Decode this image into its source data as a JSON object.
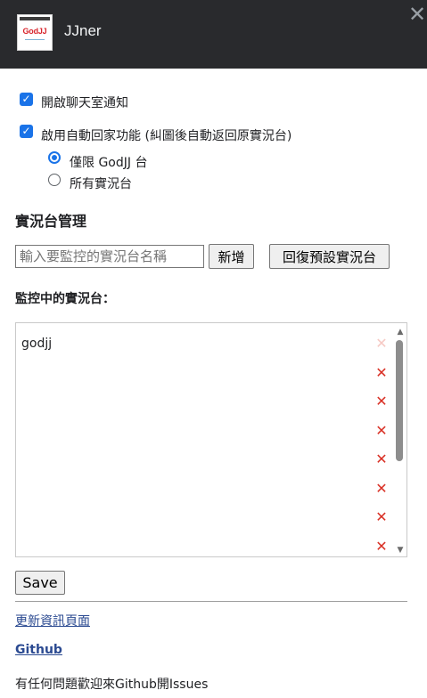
{
  "header": {
    "logo_text": "GodJJ",
    "app_title": "JJner",
    "close_glyph": "✕"
  },
  "settings": {
    "notify_label": "開啟聊天室通知",
    "notify_checked": true,
    "autohome_label": "啟用自動回家功能 (糾圖後自動返回原實況台)",
    "autohome_checked": true,
    "radio_options": [
      "僅限 GodJJ 台",
      "所有實況台"
    ],
    "radio_selected": 0
  },
  "manage": {
    "title": "實況台管理",
    "input_value": "",
    "input_placeholder": "輸入要監控的實況台名稱",
    "add_label": "新增",
    "reset_label": "回復預設實況台"
  },
  "monitor": {
    "title": "監控中的實況台：",
    "items": [
      "godjj"
    ],
    "delete_glyph": "✕"
  },
  "save_label": "Save",
  "links": {
    "update_page": "更新資訊頁面",
    "github": "Github"
  },
  "footer_text": "有任何問題歡迎來Github開Issues",
  "colors": {
    "titlebar": "#292a2d",
    "accent": "#1a73e8",
    "delete": "#d93025",
    "link": "#2b4a91"
  }
}
